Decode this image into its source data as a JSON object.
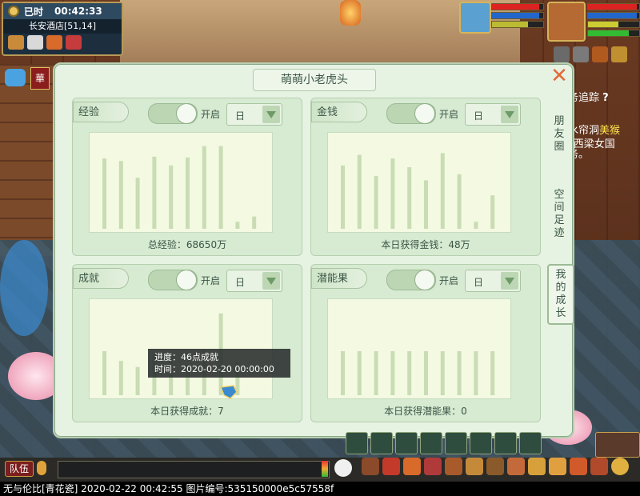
{
  "hud": {
    "time_label": "已时",
    "time_value": "00:42:33",
    "location": "长安酒店[51,14]"
  },
  "quest": {
    "title": "务追踪",
    "help": "?",
    "line1_pre": "水帘洞",
    "line1_hl": "美猴",
    "line2": "“西梁女国",
    "line3": "务。"
  },
  "dialog": {
    "title": "萌萌小老虎头",
    "close": "✕",
    "toggle_label": "开启",
    "period": "日",
    "cards": [
      {
        "tag": "经验",
        "summary": "总经验：68650万",
        "chart_data": {
          "type": "bar",
          "values": [
            80,
            77,
            58,
            82,
            72,
            81,
            94,
            94,
            8,
            14
          ],
          "ylim": [
            0,
            100
          ]
        }
      },
      {
        "tag": "金钱",
        "summary": "本日获得金钱：48万",
        "chart_data": {
          "type": "bar",
          "values": [
            72,
            84,
            60,
            80,
            70,
            55,
            86,
            62,
            8,
            38
          ],
          "ylim": [
            0,
            100
          ]
        }
      },
      {
        "tag": "成就",
        "summary": "本日获得成就：7",
        "chart_data": {
          "type": "bar",
          "values": [
            50,
            39,
            32,
            46,
            46,
            34,
            50,
            93,
            38,
            0
          ],
          "ylim": [
            0,
            100
          ]
        }
      },
      {
        "tag": "潜能果",
        "summary": "本日获得潜能果：0",
        "chart_data": {
          "type": "bar",
          "values": [
            50,
            50,
            50,
            50,
            50,
            50,
            50,
            50,
            50,
            50
          ],
          "ylim": [
            0,
            100
          ]
        }
      }
    ],
    "tabs": [
      "朋友圈",
      "空间足迹",
      "我的成长"
    ],
    "tooltip": {
      "line1": "进度：46点成就",
      "line2": "时间：2020-02-20 00:00:00"
    }
  },
  "bottom": {
    "team": "队伍",
    "status": "无与伦比[青花瓷] 2020-02-22 00:42:55 图片编号:535150000e5c57558f"
  },
  "colors": {
    "bar": "#c9dcb4",
    "plot_bg": "#f4f9e2",
    "accent": "#e06a3a"
  }
}
